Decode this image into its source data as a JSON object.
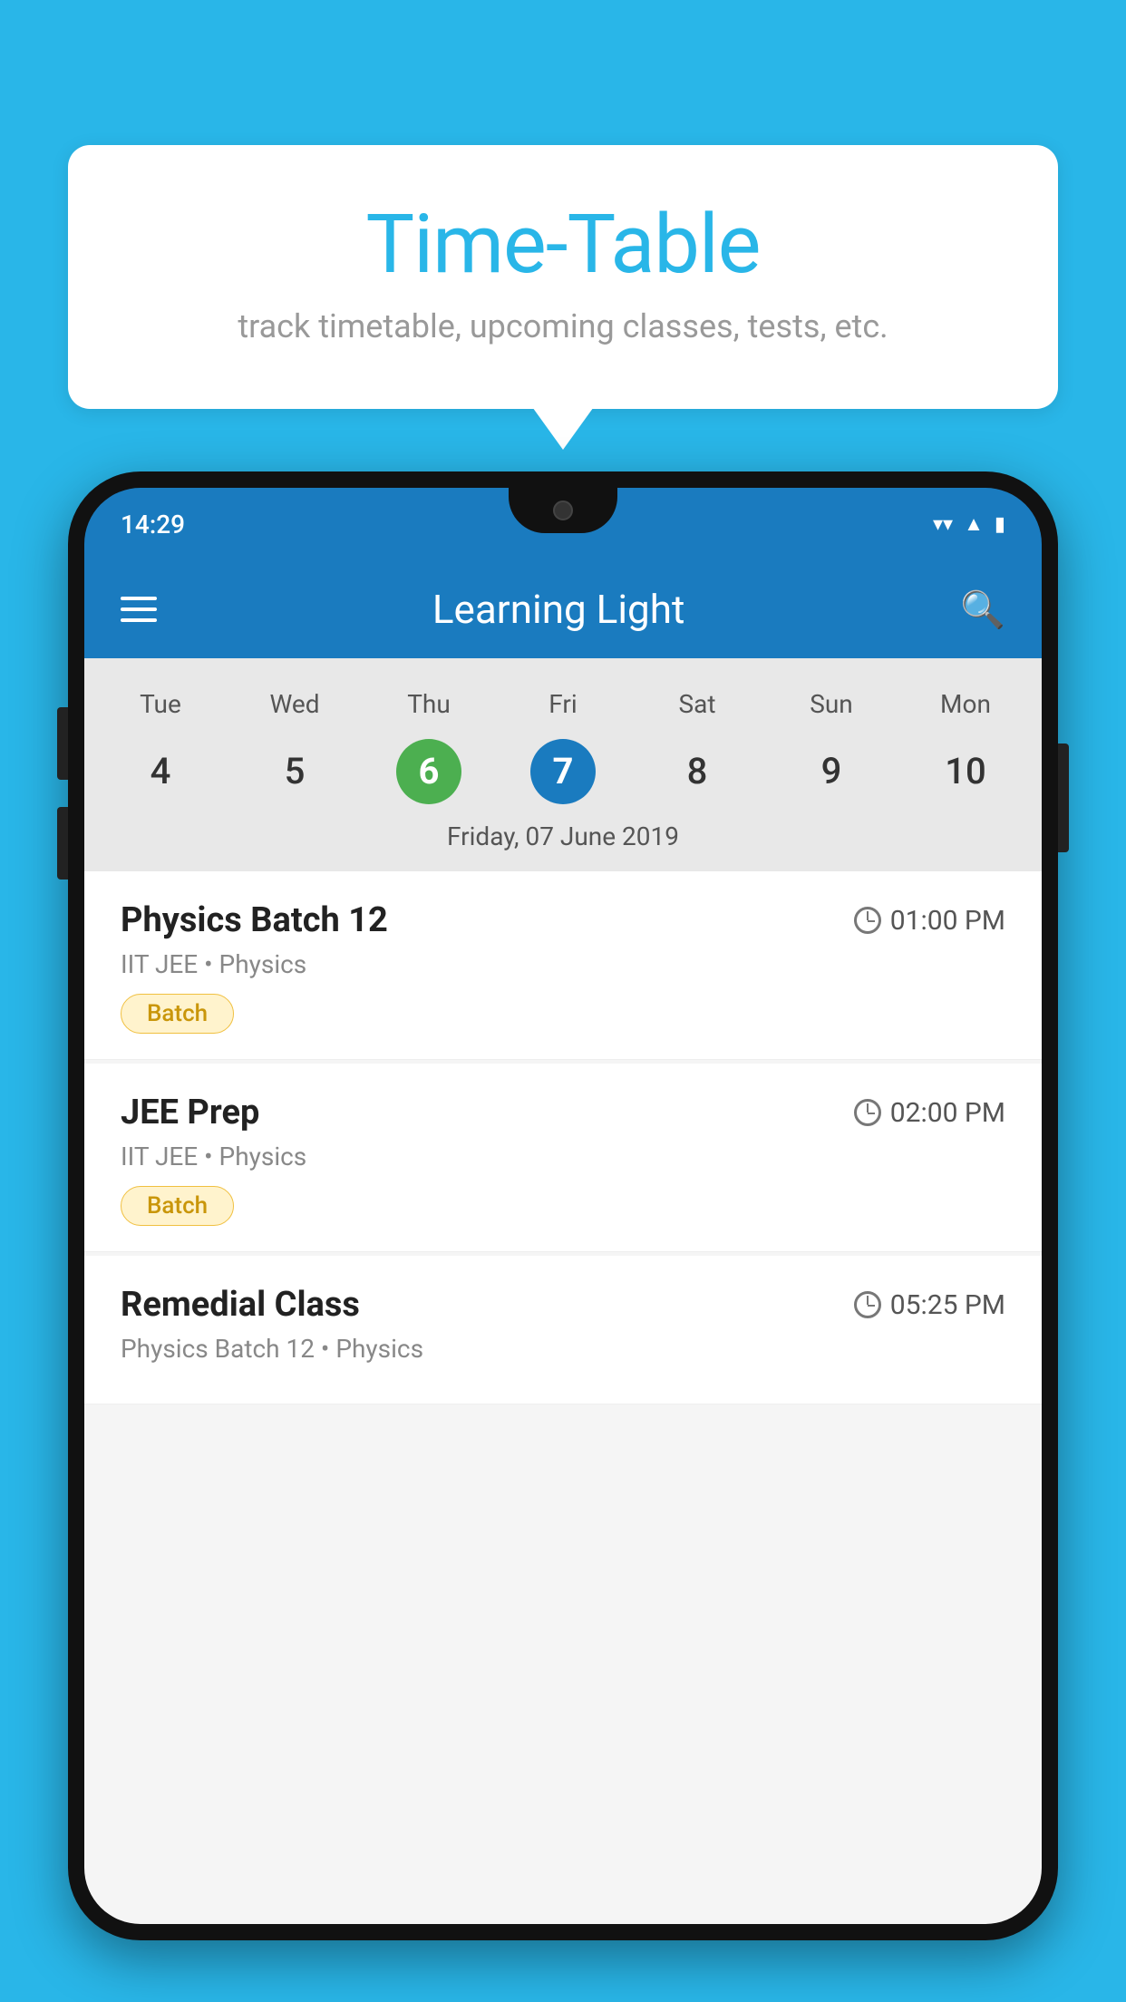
{
  "background_color": "#29b6e8",
  "speech_bubble": {
    "title": "Time-Table",
    "subtitle": "track timetable, upcoming classes, tests, etc."
  },
  "status_bar": {
    "time": "14:29",
    "wifi": "▼",
    "signal": "▲",
    "battery": "▮"
  },
  "app": {
    "title": "Learning Light"
  },
  "calendar": {
    "days": [
      "Tue",
      "Wed",
      "Thu",
      "Fri",
      "Sat",
      "Sun",
      "Mon"
    ],
    "dates": [
      "4",
      "5",
      "6",
      "7",
      "8",
      "9",
      "10"
    ],
    "today_index": 2,
    "selected_index": 3,
    "selected_date_label": "Friday, 07 June 2019"
  },
  "schedule": [
    {
      "name": "Physics Batch 12",
      "time": "01:00 PM",
      "meta": "IIT JEE • Physics",
      "badge": "Batch"
    },
    {
      "name": "JEE Prep",
      "time": "02:00 PM",
      "meta": "IIT JEE • Physics",
      "badge": "Batch"
    },
    {
      "name": "Remedial Class",
      "time": "05:25 PM",
      "meta": "Physics Batch 12 • Physics",
      "badge": null
    }
  ]
}
